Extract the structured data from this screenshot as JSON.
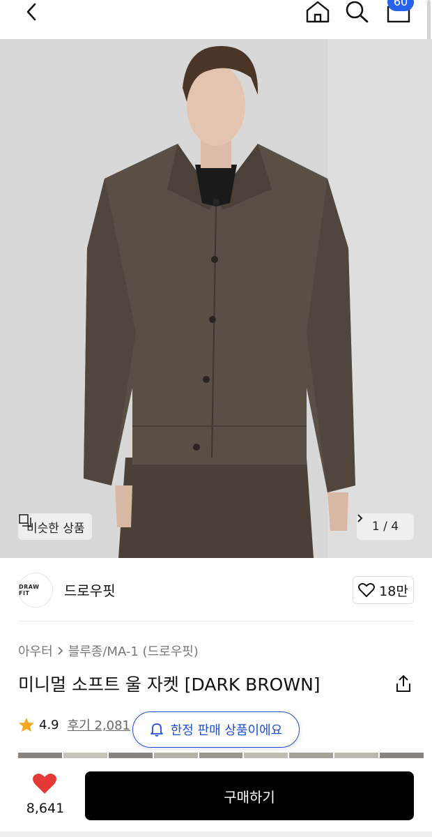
{
  "header": {
    "back_icon": "chevron-left-icon",
    "home_icon": "home-icon",
    "search_icon": "search-icon",
    "cart_icon": "cart-icon",
    "cart_count": "60",
    "badge_color": "#2563eb"
  },
  "hero": {
    "image_description": "product-photo",
    "similar_label": "비슷한 상품",
    "page_indicator": "1 / 4",
    "current_page": 1,
    "total_pages": 4
  },
  "brand": {
    "logo_text": "DRAW FIT",
    "name": "드로우핏",
    "like_count": "18만"
  },
  "product": {
    "breadcrumb": [
      "아우터",
      "블루종/MA-1 (드로우핏)"
    ],
    "title": "미니멀 소프트 울 자켓 [DARK BROWN]",
    "rating": "4.9",
    "reviews": "후기 2,081",
    "limited_notice": "한정 판매 상품이에요"
  },
  "bottom": {
    "wish_count": "8,641",
    "buy_label": "구매하기",
    "heart_color": "#e53935"
  }
}
